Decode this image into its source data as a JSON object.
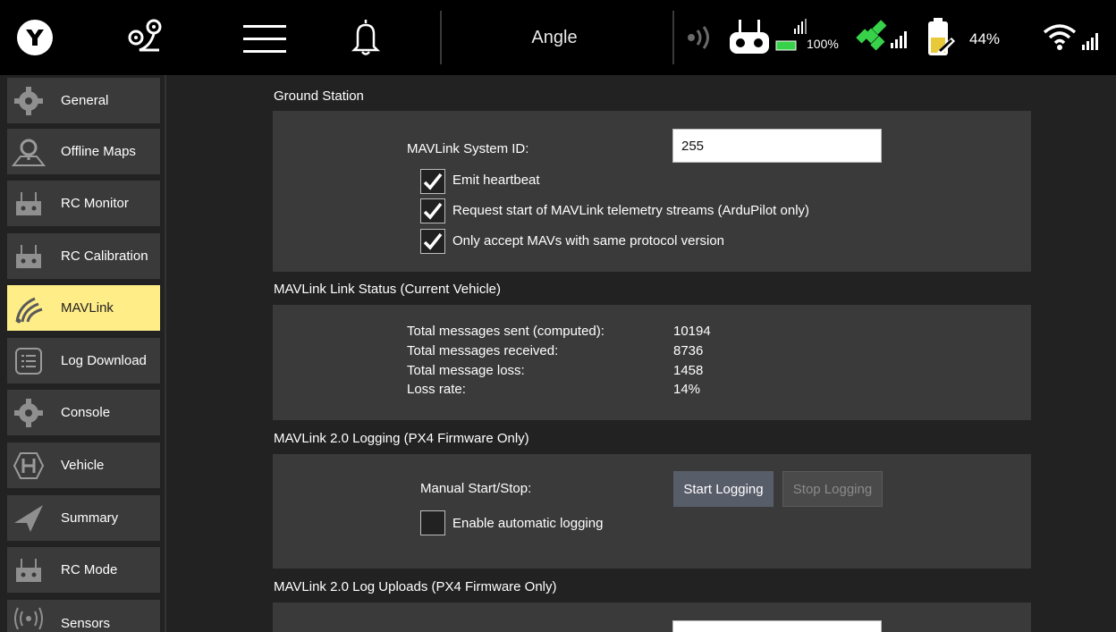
{
  "toolbar": {
    "flight_mode": "Angle",
    "rc_rssi": "100%",
    "battery": "44%"
  },
  "sidebar": {
    "items": [
      {
        "label": "General",
        "icon": "gear-icon"
      },
      {
        "label": "Offline Maps",
        "icon": "map-pin-icon"
      },
      {
        "label": "RC Monitor",
        "icon": "rc-transmitter-icon"
      },
      {
        "label": "RC Calibration",
        "icon": "rc-transmitter-icon"
      },
      {
        "label": "MAVLink",
        "icon": "signal-waves-icon"
      },
      {
        "label": "Log Download",
        "icon": "list-icon"
      },
      {
        "label": "Console",
        "icon": "gear-icon"
      },
      {
        "label": "Vehicle",
        "icon": "hexagon-h-icon"
      },
      {
        "label": "Summary",
        "icon": "paper-plane-icon"
      },
      {
        "label": "RC Mode",
        "icon": "rc-transmitter-icon"
      },
      {
        "label": "Sensors",
        "icon": "radio-waves-icon"
      }
    ],
    "active": "MAVLink"
  },
  "ground_station": {
    "title": "Ground Station",
    "system_id_label": "MAVLink System ID:",
    "system_id_value": "255",
    "checkboxes": [
      {
        "label": "Emit heartbeat",
        "checked": true
      },
      {
        "label": "Request start of MAVLink telemetry streams (ArduPilot only)",
        "checked": true
      },
      {
        "label": "Only accept MAVs with same protocol version",
        "checked": true
      }
    ]
  },
  "link_status": {
    "title": "MAVLink Link Status (Current Vehicle)",
    "rows": [
      {
        "label": "Total messages sent (computed):",
        "value": "10194"
      },
      {
        "label": "Total messages received:",
        "value": "8736"
      },
      {
        "label": "Total message loss:",
        "value": "1458"
      },
      {
        "label": "Loss rate:",
        "value": "14%"
      }
    ]
  },
  "logging": {
    "title": "MAVLink 2.0 Logging (PX4 Firmware Only)",
    "manual_label": "Manual Start/Stop:",
    "start_button": "Start Logging",
    "stop_button": "Stop Logging",
    "auto_label": "Enable automatic logging",
    "auto_checked": false
  },
  "log_uploads": {
    "title": "MAVLink 2.0 Log Uploads (PX4 Firmware Only)"
  },
  "colors": {
    "active_tab": "#ffed87",
    "panel": "#3a3a3a",
    "background": "#222222",
    "gps_green": "#37d24a"
  }
}
